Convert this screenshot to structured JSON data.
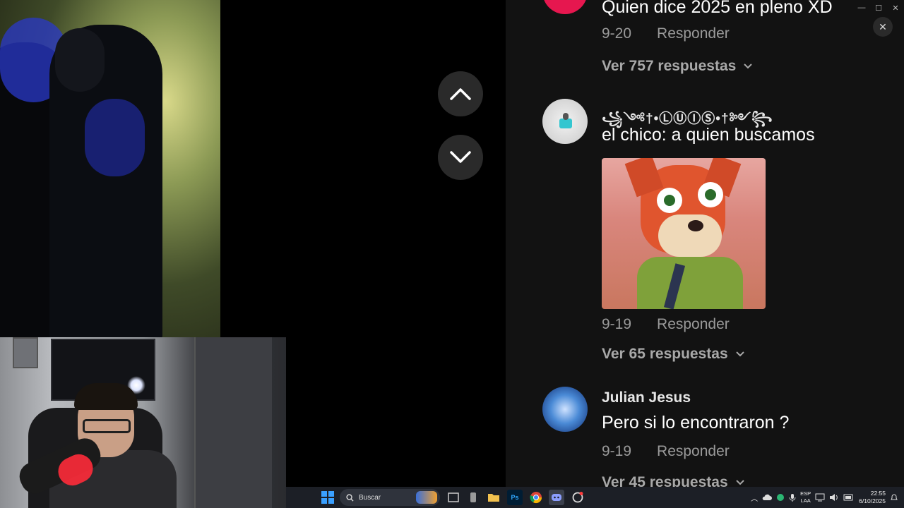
{
  "window": {
    "minimize": "—",
    "maximize": "☐",
    "close": "✕"
  },
  "panel": {
    "close_label": "✕"
  },
  "comments": [
    {
      "text": "Quien dice 2025 en pleno XD",
      "date": "9-20",
      "reply_label": "Responder",
      "replies_label": "Ver 757 respuestas"
    },
    {
      "username": "꧁༺†•ⓁⓊⒾⓈ•†༻꧂",
      "text": "el chico: a quien buscamos",
      "date": "9-19",
      "reply_label": "Responder",
      "replies_label": "Ver 65 respuestas"
    },
    {
      "username": "Julian Jesus",
      "text": "Pero si lo encontraron ?",
      "date": "9-19",
      "reply_label": "Responder",
      "replies_label": "Ver 45 respuestas"
    }
  ],
  "taskbar": {
    "search_placeholder": "Buscar",
    "lang_top": "ESP",
    "lang_bottom": "LAA",
    "time": "22:55",
    "date": "6/10/2025"
  },
  "colors": {
    "comments_bg": "#121212",
    "taskbar_bg": "#1c1f26",
    "accent_start": "#0078d4"
  }
}
